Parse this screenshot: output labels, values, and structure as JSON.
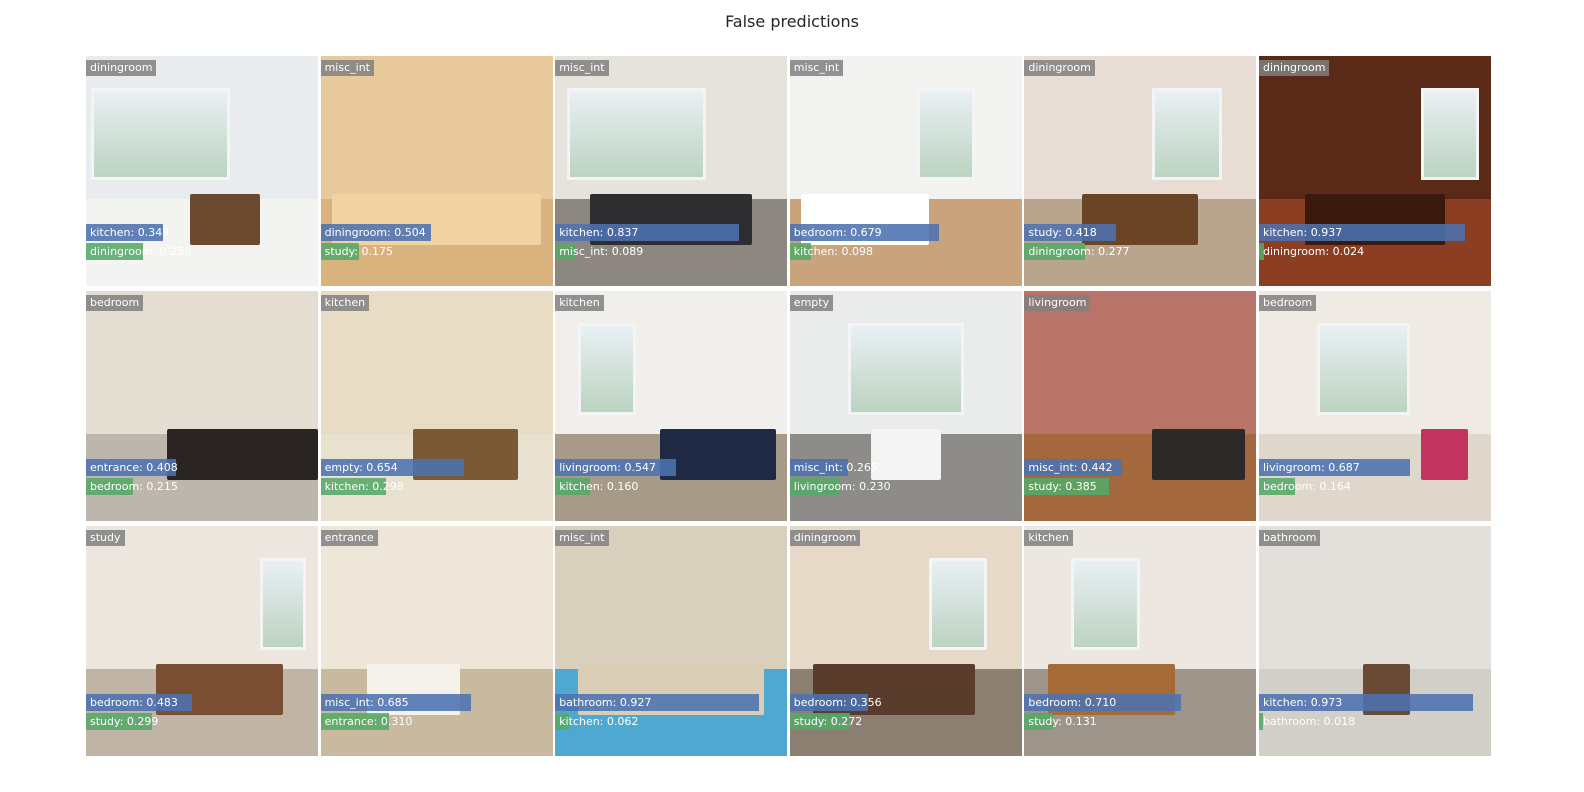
{
  "chart_data": {
    "type": "image-grid",
    "title": "False predictions",
    "rows": 3,
    "cols": 6,
    "bar_colors": {
      "first": "#4C72B0",
      "second": "#55A868",
      "label_bg": "#808080"
    },
    "items": [
      {
        "true_label": "diningroom",
        "pred1_label": "kitchen",
        "pred1_score": 0.349,
        "pred2_label": "diningroom",
        "pred2_score": 0.258,
        "scene": "kitchen-white"
      },
      {
        "true_label": "misc_int",
        "pred1_label": "diningroom",
        "pred1_score": 0.504,
        "pred2_label": "study",
        "pred2_score": 0.175,
        "scene": "cabinet-wood"
      },
      {
        "true_label": "misc_int",
        "pred1_label": "kitchen",
        "pred1_score": 0.837,
        "pred2_label": "misc_int",
        "pred2_score": 0.089,
        "scene": "gym"
      },
      {
        "true_label": "misc_int",
        "pred1_label": "bedroom",
        "pred1_score": 0.679,
        "pred2_label": "kitchen",
        "pred2_score": 0.098,
        "scene": "white-room"
      },
      {
        "true_label": "diningroom",
        "pred1_label": "study",
        "pred1_score": 0.418,
        "pred2_label": "diningroom",
        "pred2_score": 0.277,
        "scene": "dining-red"
      },
      {
        "true_label": "diningroom",
        "pred1_label": "kitchen",
        "pred1_score": 0.937,
        "pred2_label": "diningroom",
        "pred2_score": 0.024,
        "scene": "dark-wood"
      },
      {
        "true_label": "bedroom",
        "pred1_label": "entrance",
        "pred1_score": 0.408,
        "pred2_label": "bedroom",
        "pred2_score": 0.215,
        "scene": "bedroom-dark"
      },
      {
        "true_label": "kitchen",
        "pred1_label": "empty",
        "pred1_score": 0.654,
        "pred2_label": "kitchen",
        "pred2_score": 0.298,
        "scene": "hall-kitchen"
      },
      {
        "true_label": "kitchen",
        "pred1_label": "livingroom",
        "pred1_score": 0.547,
        "pred2_label": "kitchen",
        "pred2_score": 0.16,
        "scene": "kitchen-navy"
      },
      {
        "true_label": "empty",
        "pred1_label": "misc_int",
        "pred1_score": 0.265,
        "pred2_label": "livingroom",
        "pred2_score": 0.23,
        "scene": "bay-window"
      },
      {
        "true_label": "livingroom",
        "pred1_label": "misc_int",
        "pred1_score": 0.442,
        "pred2_label": "study",
        "pred2_score": 0.385,
        "scene": "living-pink"
      },
      {
        "true_label": "bedroom",
        "pred1_label": "livingroom",
        "pred1_score": 0.687,
        "pred2_label": "bedroom",
        "pred2_score": 0.164,
        "scene": "bedroom-light"
      },
      {
        "true_label": "study",
        "pred1_label": "bedroom",
        "pred1_score": 0.483,
        "pred2_label": "study",
        "pred2_score": 0.299,
        "scene": "attic-study"
      },
      {
        "true_label": "entrance",
        "pred1_label": "misc_int",
        "pred1_score": 0.685,
        "pred2_label": "entrance",
        "pred2_score": 0.31,
        "scene": "hallway"
      },
      {
        "true_label": "misc_int",
        "pred1_label": "bathroom",
        "pred1_score": 0.927,
        "pred2_label": "kitchen",
        "pred2_score": 0.062,
        "scene": "pool"
      },
      {
        "true_label": "diningroom",
        "pred1_label": "bedroom",
        "pred1_score": 0.356,
        "pred2_label": "study",
        "pred2_score": 0.272,
        "scene": "cluttered"
      },
      {
        "true_label": "kitchen",
        "pred1_label": "bedroom",
        "pred1_score": 0.71,
        "pred2_label": "study",
        "pred2_score": 0.131,
        "scene": "kitchen-wood"
      },
      {
        "true_label": "bathroom",
        "pred1_label": "kitchen",
        "pred1_score": 0.973,
        "pred2_label": "bathroom",
        "pred2_score": 0.018,
        "scene": "bathroom-marble"
      }
    ]
  }
}
